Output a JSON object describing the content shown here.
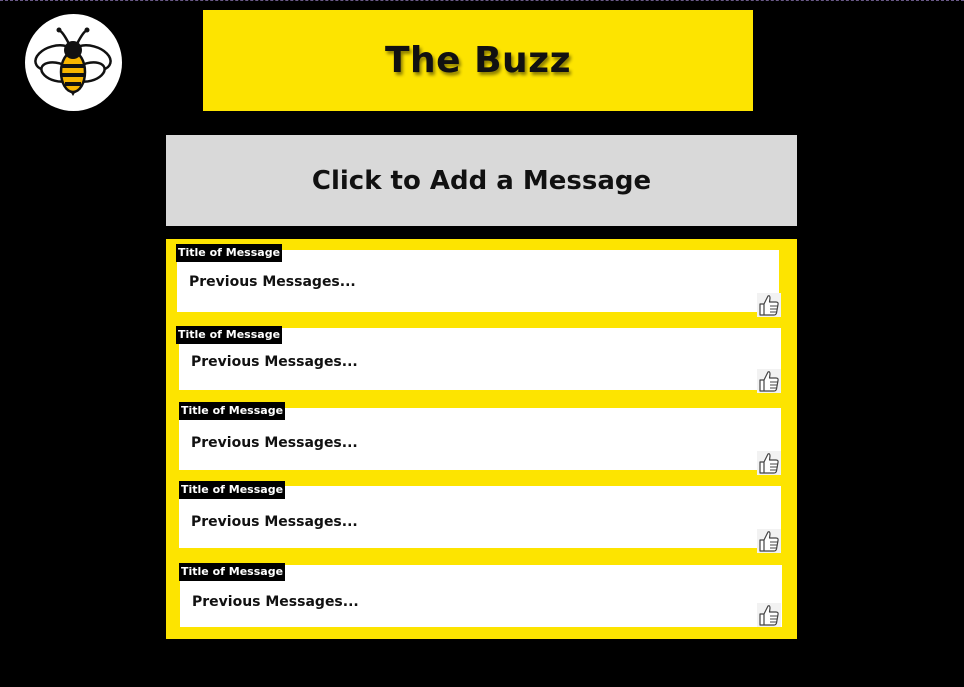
{
  "app": {
    "title": "The Buzz",
    "logo_icon": "bee-icon"
  },
  "composer": {
    "label": "Click to Add a Message"
  },
  "messages": [
    {
      "title": "Title of Message",
      "body": "Previous Messages...",
      "like_icon": "thumbs-up-icon"
    },
    {
      "title": "Title of Message",
      "body": "Previous Messages...",
      "like_icon": "thumbs-up-icon"
    },
    {
      "title": "Title of Message",
      "body": "Previous Messages...",
      "like_icon": "thumbs-up-icon"
    },
    {
      "title": "Title of Message",
      "body": "Previous Messages...",
      "like_icon": "thumbs-up-icon"
    },
    {
      "title": "Title of Message",
      "body": "Previous Messages...",
      "like_icon": "thumbs-up-icon"
    }
  ],
  "colors": {
    "background": "#000000",
    "accent_yellow": "#fde400",
    "composer_gray": "#d9d9d9"
  }
}
